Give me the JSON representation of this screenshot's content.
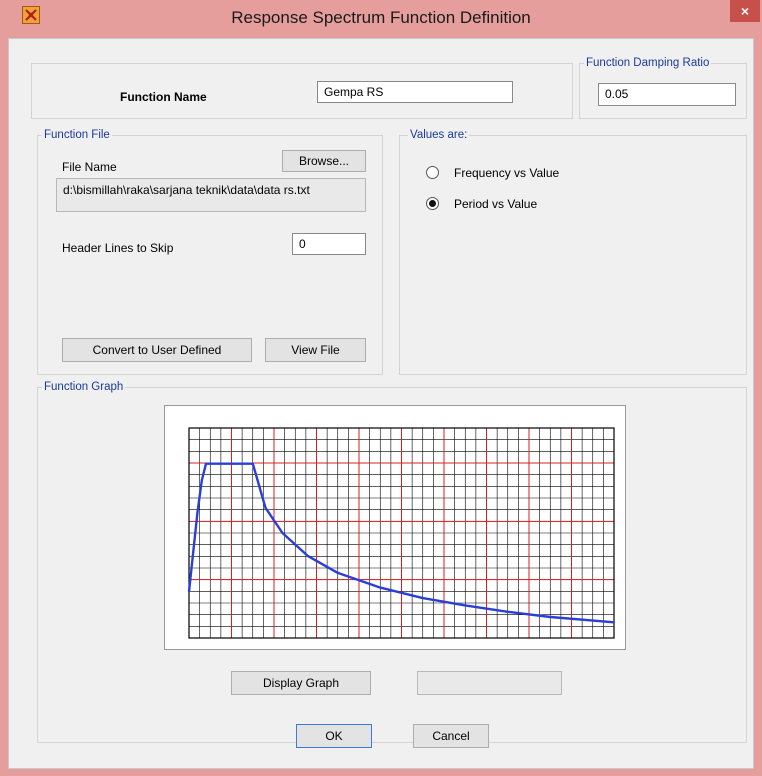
{
  "window": {
    "title": "Response Spectrum  Function Definition",
    "close_glyph": "×",
    "icon": "app-icon"
  },
  "function_name": {
    "label": "Function Name",
    "value": "Gempa RS"
  },
  "damping": {
    "legend": "Function Damping Ratio",
    "value": "0.05"
  },
  "function_file": {
    "legend": "Function File",
    "file_name_label": "File Name",
    "browse_label": "Browse...",
    "path": "d:\\bismillah\\raka\\sarjana teknik\\data\\data rs.txt",
    "header_lines_label": "Header Lines to Skip",
    "header_lines_value": "0",
    "convert_label": "Convert to User Defined",
    "view_file_label": "View File"
  },
  "values_are": {
    "legend": "Values are:",
    "options": [
      {
        "label": "Frequency vs Value",
        "selected": false
      },
      {
        "label": "Period vs Value",
        "selected": true
      }
    ]
  },
  "function_graph": {
    "legend": "Function Graph",
    "display_graph_label": "Display Graph",
    "readout": ""
  },
  "chart_data": {
    "type": "line",
    "grid": true,
    "series": [
      {
        "color": "#2a3fd6",
        "points": [
          [
            0.0,
            0.22
          ],
          [
            0.02,
            0.6
          ],
          [
            0.03,
            0.75
          ],
          [
            0.04,
            0.83
          ],
          [
            0.15,
            0.83
          ],
          [
            0.18,
            0.62
          ],
          [
            0.22,
            0.5
          ],
          [
            0.28,
            0.39
          ],
          [
            0.35,
            0.31
          ],
          [
            0.45,
            0.24
          ],
          [
            0.55,
            0.19
          ],
          [
            0.65,
            0.155
          ],
          [
            0.75,
            0.125
          ],
          [
            0.85,
            0.1
          ],
          [
            1.0,
            0.075
          ]
        ]
      }
    ],
    "colors": {
      "minor_grid": "#000000",
      "major_grid": "#d42020"
    }
  },
  "footer": {
    "ok_label": "OK",
    "cancel_label": "Cancel"
  }
}
